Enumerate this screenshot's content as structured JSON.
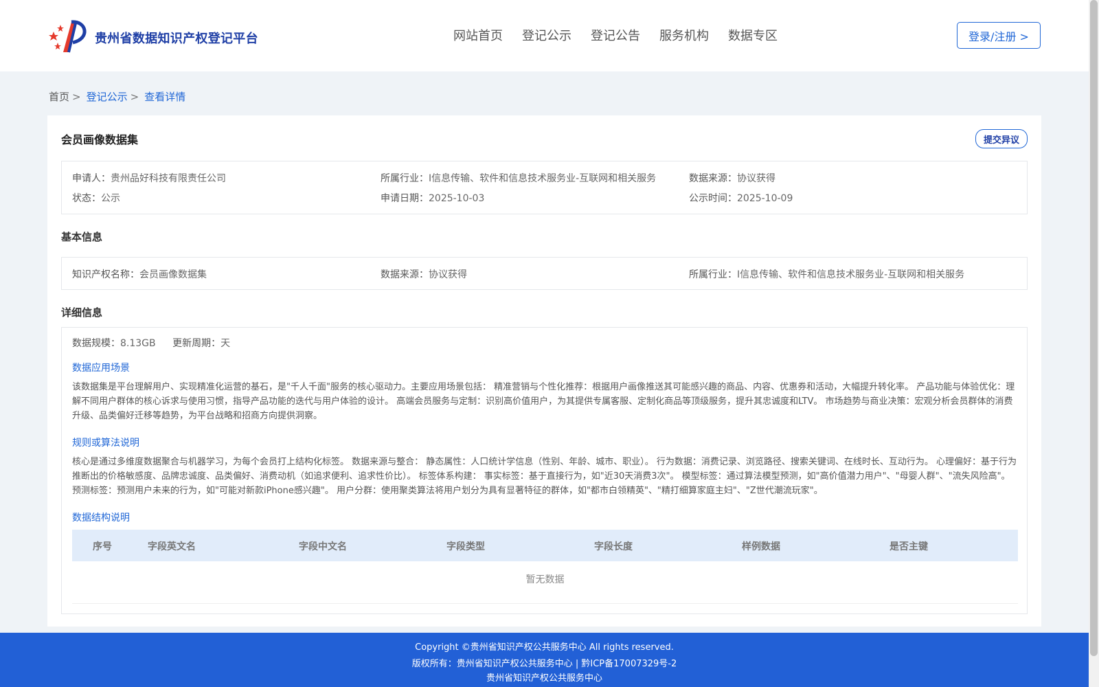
{
  "header": {
    "site_name": "贵州省数据知识产权登记平台",
    "nav": [
      "网站首页",
      "登记公示",
      "登记公告",
      "服务机构",
      "数据专区"
    ],
    "login_label": "登录/注册 >"
  },
  "breadcrumb": {
    "home": "首页",
    "sep": ">",
    "items": [
      "登记公示",
      "查看详情"
    ]
  },
  "dataset": {
    "title": "会员画像数据集",
    "objection_label": "提交异议",
    "summary": {
      "applicant_label": "申请人：",
      "applicant": "贵州品好科技有限责任公司",
      "industry_label": "所属行业：",
      "industry": "I信息传输、软件和信息技术服务业-互联网和相关服务",
      "source_label": "数据来源：",
      "source": "协议获得",
      "status_label": "状态：",
      "status": "公示",
      "apply_date_label": "申请日期：",
      "apply_date": "2025-10-03",
      "publish_date_label": "公示时间：",
      "publish_date": "2025-10-09"
    },
    "basic": {
      "section_title": "基本信息",
      "ip_name_label": "知识产权名称：",
      "ip_name": "会员画像数据集",
      "source_label": "数据来源：",
      "source": "协议获得",
      "industry_label": "所属行业：",
      "industry": "I信息传输、软件和信息技术服务业-互联网和相关服务"
    },
    "detail": {
      "section_title": "详细信息",
      "scale_label": "数据规模：",
      "scale": "8.13GB",
      "cycle_label": "更新周期：",
      "cycle": "天",
      "scenario_title": "数据应用场景",
      "scenario_text": "该数据集是平台理解用户、实现精准化运营的基石，是\"千人千面\"服务的核心驱动力。主要应用场景包括： 精准营销与个性化推荐：根据用户画像推送其可能感兴趣的商品、内容、优惠券和活动，大幅提升转化率。 产品功能与体验优化：理解不同用户群体的核心诉求与使用习惯，指导产品功能的迭代与用户体验的设计。 高端会员服务与定制：识别高价值用户，为其提供专属客服、定制化商品等顶级服务，提升其忠诚度和LTV。 市场趋势与商业决策：宏观分析会员群体的消费升级、品类偏好迁移等趋势，为平台战略和招商方向提供洞察。",
      "rules_title": "规则或算法说明",
      "rules_text": "核心是通过多维度数据聚合与机器学习，为每个会员打上结构化标签。 数据来源与整合： 静态属性：人口统计学信息（性别、年龄、城市、职业）。 行为数据：消费记录、浏览路径、搜索关键词、在线时长、互动行为。 心理偏好：基于行为推断出的价格敏感度、品牌忠诚度、品类偏好、消费动机（如追求便利、追求性价比）。 标签体系构建： 事实标签：基于直接行为，如\"近30天消费3次\"。 模型标签：通过算法模型预测，如\"高价值潜力用户\"、\"母婴人群\"、\"流失风险高\"。 预测标签：预测用户未来的行为，如\"可能对新款iPhone感兴趣\"。 用户分群：使用聚类算法将用户划分为具有显著特征的群体，如\"都市白领精英\"、\"精打细算家庭主妇\"、\"Z世代潮流玩家\"。",
      "structure_title": "数据结构说明",
      "table_headers": [
        "序号",
        "字段英文名",
        "字段中文名",
        "字段类型",
        "字段长度",
        "样例数据",
        "是否主键"
      ],
      "empty_text": "暂无数据"
    }
  },
  "footer": {
    "copyright": "Copyright ©贵州省知识产权公共服务中心 All rights reserved.",
    "rights": "版权所有：贵州省知识产权公共服务中心 | 黔ICP备17007329号-2",
    "org": "贵州省知识产权公共服务中心"
  },
  "colors": {
    "brand_blue": "#1f66d6",
    "footer_blue": "#2260d6",
    "logo_red": "#e53a2c"
  }
}
